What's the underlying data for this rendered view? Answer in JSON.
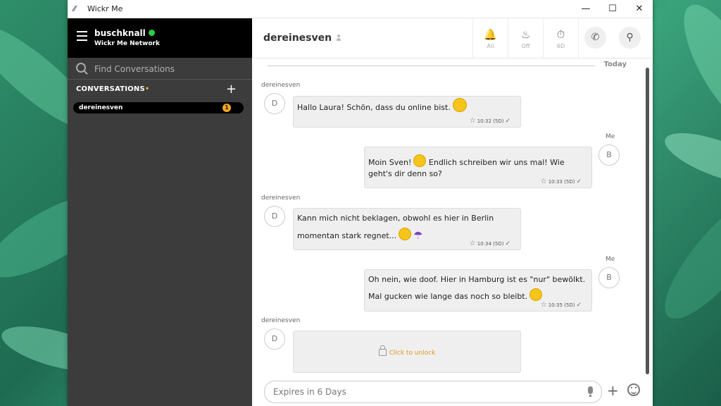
{
  "window": {
    "title": "Wickr Me"
  },
  "sidebar": {
    "username": "buschknall",
    "network": "Wickr Me Network",
    "search_placeholder": "Find Conversations",
    "section_title": "CONVERSATIONS",
    "conversations": [
      {
        "name": "dereinesven",
        "unread": "1"
      }
    ]
  },
  "chat": {
    "title": "dereinesven",
    "header_buttons": [
      {
        "icon": "bell-icon",
        "label": "All"
      },
      {
        "icon": "flame-icon",
        "label": "Off"
      },
      {
        "icon": "timer-icon",
        "label": "6D"
      }
    ],
    "date_divider": "Today",
    "messages": [
      {
        "sender": "dereinesven",
        "avatar": "D",
        "text": "Hallo Laura! Schön, dass du online bist.",
        "time": "10:32",
        "expiry": "(5D)"
      },
      {
        "sender": "Me",
        "avatar": "B",
        "text1": "Moin Sven!",
        "text2": "Endlich schreiben wir uns mal! Wie",
        "text3": "geht's dir denn so?",
        "time": "10:33",
        "expiry": "(5D)"
      },
      {
        "sender": "dereinesven",
        "avatar": "D",
        "text1": "Kann mich nicht beklagen, obwohl es hier in Berlin",
        "text2": "momentan stark regnet...",
        "time": "10:34",
        "expiry": "(5D)"
      },
      {
        "sender": "Me",
        "avatar": "B",
        "text1": "Oh nein, wie doof. Hier in Hamburg ist es \"nur\" bewölkt.",
        "text2": "Mal gucken wie lange das noch so bleibt.",
        "time": "10:35",
        "expiry": "(5D)"
      },
      {
        "sender": "dereinesven",
        "avatar": "D",
        "locked_text": "Click to unlock"
      }
    ],
    "composer_placeholder": "Expires in 6 Days"
  },
  "colors": {
    "online": "#2ecc40",
    "badge": "#f5a623",
    "unlock": "#e09a1b"
  }
}
